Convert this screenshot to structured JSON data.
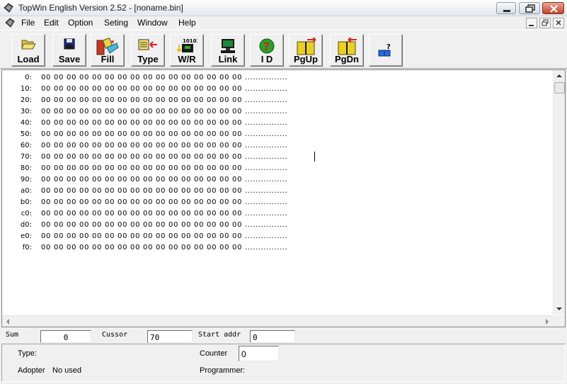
{
  "window": {
    "title": "TopWin  English Version 2.52  - [noname.bin]"
  },
  "menu": [
    "File",
    "Edit",
    "Option",
    "Seting",
    "Window",
    "Help"
  ],
  "toolbar": {
    "load": "Load",
    "save": "Save",
    "fill": "Fill",
    "type": "Type",
    "wr": "W/R",
    "wr_icon_text": "10101",
    "link": "Link",
    "id": "I D",
    "pgup": "PgUp",
    "pgdn": "PgDn"
  },
  "hex": {
    "rows": [
      {
        "addr": "0:",
        "bytes": "00 00 00 00 00 00 00 00 00 00 00 00 00 00 00 00",
        "ascii": "................"
      },
      {
        "addr": "10:",
        "bytes": "00 00 00 00 00 00 00 00 00 00 00 00 00 00 00 00",
        "ascii": "................"
      },
      {
        "addr": "20:",
        "bytes": "00 00 00 00 00 00 00 00 00 00 00 00 00 00 00 00",
        "ascii": "................"
      },
      {
        "addr": "30:",
        "bytes": "00 00 00 00 00 00 00 00 00 00 00 00 00 00 00 00",
        "ascii": "................"
      },
      {
        "addr": "40:",
        "bytes": "00 00 00 00 00 00 00 00 00 00 00 00 00 00 00 00",
        "ascii": "................"
      },
      {
        "addr": "50:",
        "bytes": "00 00 00 00 00 00 00 00 00 00 00 00 00 00 00 00",
        "ascii": "................"
      },
      {
        "addr": "60:",
        "bytes": "00 00 00 00 00 00 00 00 00 00 00 00 00 00 00 00",
        "ascii": "................"
      },
      {
        "addr": "70:",
        "bytes": "00 00 00 00 00 00 00 00 00 00 00 00 00 00 00 00",
        "ascii": "................"
      },
      {
        "addr": "80:",
        "bytes": "00 00 00 00 00 00 00 00 00 00 00 00 00 00 00 00",
        "ascii": "................"
      },
      {
        "addr": "90:",
        "bytes": "00 00 00 00 00 00 00 00 00 00 00 00 00 00 00 00",
        "ascii": "................"
      },
      {
        "addr": "a0:",
        "bytes": "00 00 00 00 00 00 00 00 00 00 00 00 00 00 00 00",
        "ascii": "................"
      },
      {
        "addr": "b0:",
        "bytes": "00 00 00 00 00 00 00 00 00 00 00 00 00 00 00 00",
        "ascii": "................"
      },
      {
        "addr": "c0:",
        "bytes": "00 00 00 00 00 00 00 00 00 00 00 00 00 00 00 00",
        "ascii": "................"
      },
      {
        "addr": "d0:",
        "bytes": "00 00 00 00 00 00 00 00 00 00 00 00 00 00 00 00",
        "ascii": "................"
      },
      {
        "addr": "e0:",
        "bytes": "00 00 00 00 00 00 00 00 00 00 00 00 00 00 00 00",
        "ascii": "................"
      },
      {
        "addr": "f0:",
        "bytes": "00 00 00 00 00 00 00 00 00 00 00 00 00 00 00 00",
        "ascii": "................"
      }
    ]
  },
  "status": {
    "sum_label": "Sum",
    "sum_value": "0",
    "cursor_label": "Cussor",
    "cursor_value": "70",
    "start_label": "Start addr",
    "start_value": "0"
  },
  "info": {
    "type_label": "Type:",
    "adopter_label": "Adopter",
    "adopter_value": "No used",
    "counter_label": "Counter",
    "counter_value": "0",
    "programmer_label": "Programmer:"
  },
  "colors": {
    "close_button": "#c6432c",
    "background": "#f0f0f0"
  }
}
